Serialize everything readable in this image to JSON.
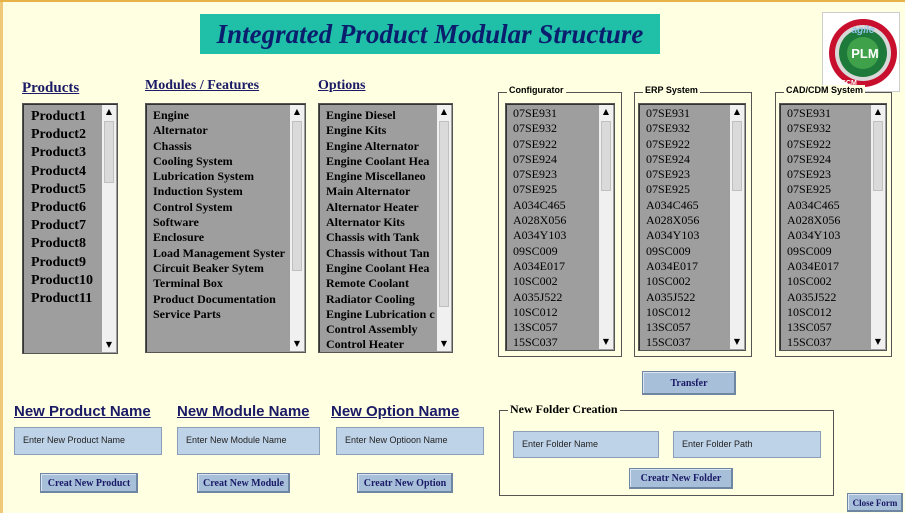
{
  "title": "Integrated Product Modular Structure",
  "logo": {
    "icon": "plm-logo-icon",
    "text_main": "PLM",
    "text_sub": "SCM",
    "text_top": "agile",
    "colors": {
      "ring": "#C8102E",
      "center": "#1E7A3A",
      "accent": "#3FA24A"
    }
  },
  "products": {
    "header": "Products",
    "items": [
      "Product1",
      "Product2",
      "Product3",
      "Product4",
      "Product5",
      "Product6",
      "Product7",
      "Product8",
      "Product9",
      "Product10",
      "Product11"
    ]
  },
  "modules": {
    "header": "Modules / Features",
    "items": [
      "Engine",
      "Alternator",
      "Chassis",
      "Cooling System",
      "Lubrication System",
      "Induction System",
      "Control System",
      "Software",
      "Enclosure",
      "Load Management Syster",
      "Circuit Beaker Sytem",
      "Terminal Box",
      "Product Documentation",
      "Service Parts"
    ]
  },
  "options": {
    "header": "Options",
    "items": [
      "Engine Diesel",
      "Engine Kits",
      "Engine Alternator",
      "Engine Coolant Hea",
      "Engine Miscellaneo",
      "Main Alternator",
      "Alternator Heater",
      "Alternator Kits",
      "Chassis with Tank",
      "Chassis without Tan",
      "Engine Coolant Hea",
      "Remote Coolant",
      "Radiator Cooling",
      "Engine Lubrication c",
      "Control Assembly",
      "Control Heater"
    ]
  },
  "configurator": {
    "label": "Configurator",
    "items": [
      "07SE931",
      "07SE932",
      "07SE922",
      "07SE924",
      "07SE923",
      "07SE925",
      "A034C465",
      "A028X056",
      "A034Y103",
      "09SC009",
      "A034E017",
      "10SC002",
      "A035J522",
      "10SC012",
      "13SC057",
      "15SC037"
    ]
  },
  "erp": {
    "label": "ERP System",
    "items": [
      "07SE931",
      "07SE932",
      "07SE922",
      "07SE924",
      "07SE923",
      "07SE925",
      "A034C465",
      "A028X056",
      "A034Y103",
      "09SC009",
      "A034E017",
      "10SC002",
      "A035J522",
      "10SC012",
      "13SC057",
      "15SC037"
    ]
  },
  "cad": {
    "label": "CAD/CDM System",
    "items": [
      "07SE931",
      "07SE932",
      "07SE922",
      "07SE924",
      "07SE923",
      "07SE925",
      "A034C465",
      "A028X056",
      "A034Y103",
      "09SC009",
      "A034E017",
      "10SC002",
      "A035J522",
      "10SC012",
      "13SC057",
      "15SC037"
    ]
  },
  "transfer_button": "Transfer",
  "new_product": {
    "title": "New Product Name",
    "placeholder": "Enter New Product Name",
    "button": "Creat New Product"
  },
  "new_module": {
    "title": "New Module Name",
    "placeholder": "Enter New Module Name",
    "button": "Creat New Module"
  },
  "new_option": {
    "title": "New Option Name",
    "placeholder": "Enter New Optioon Name",
    "button": "Creatr New Option"
  },
  "new_folder": {
    "label": "New Folder Creation",
    "name_placeholder": "Enter Folder Name",
    "path_placeholder": "Enter Folder Path",
    "button": "Creatr New Folder"
  },
  "close_button": "Close Form",
  "colors": {
    "background": "#FFFFE1",
    "title_banner": "#1FBFA8",
    "title_text": "#0B1E6E",
    "listbox": "#9E9E9E",
    "button": "#A7BFD9",
    "field": "#BFD3E8"
  }
}
